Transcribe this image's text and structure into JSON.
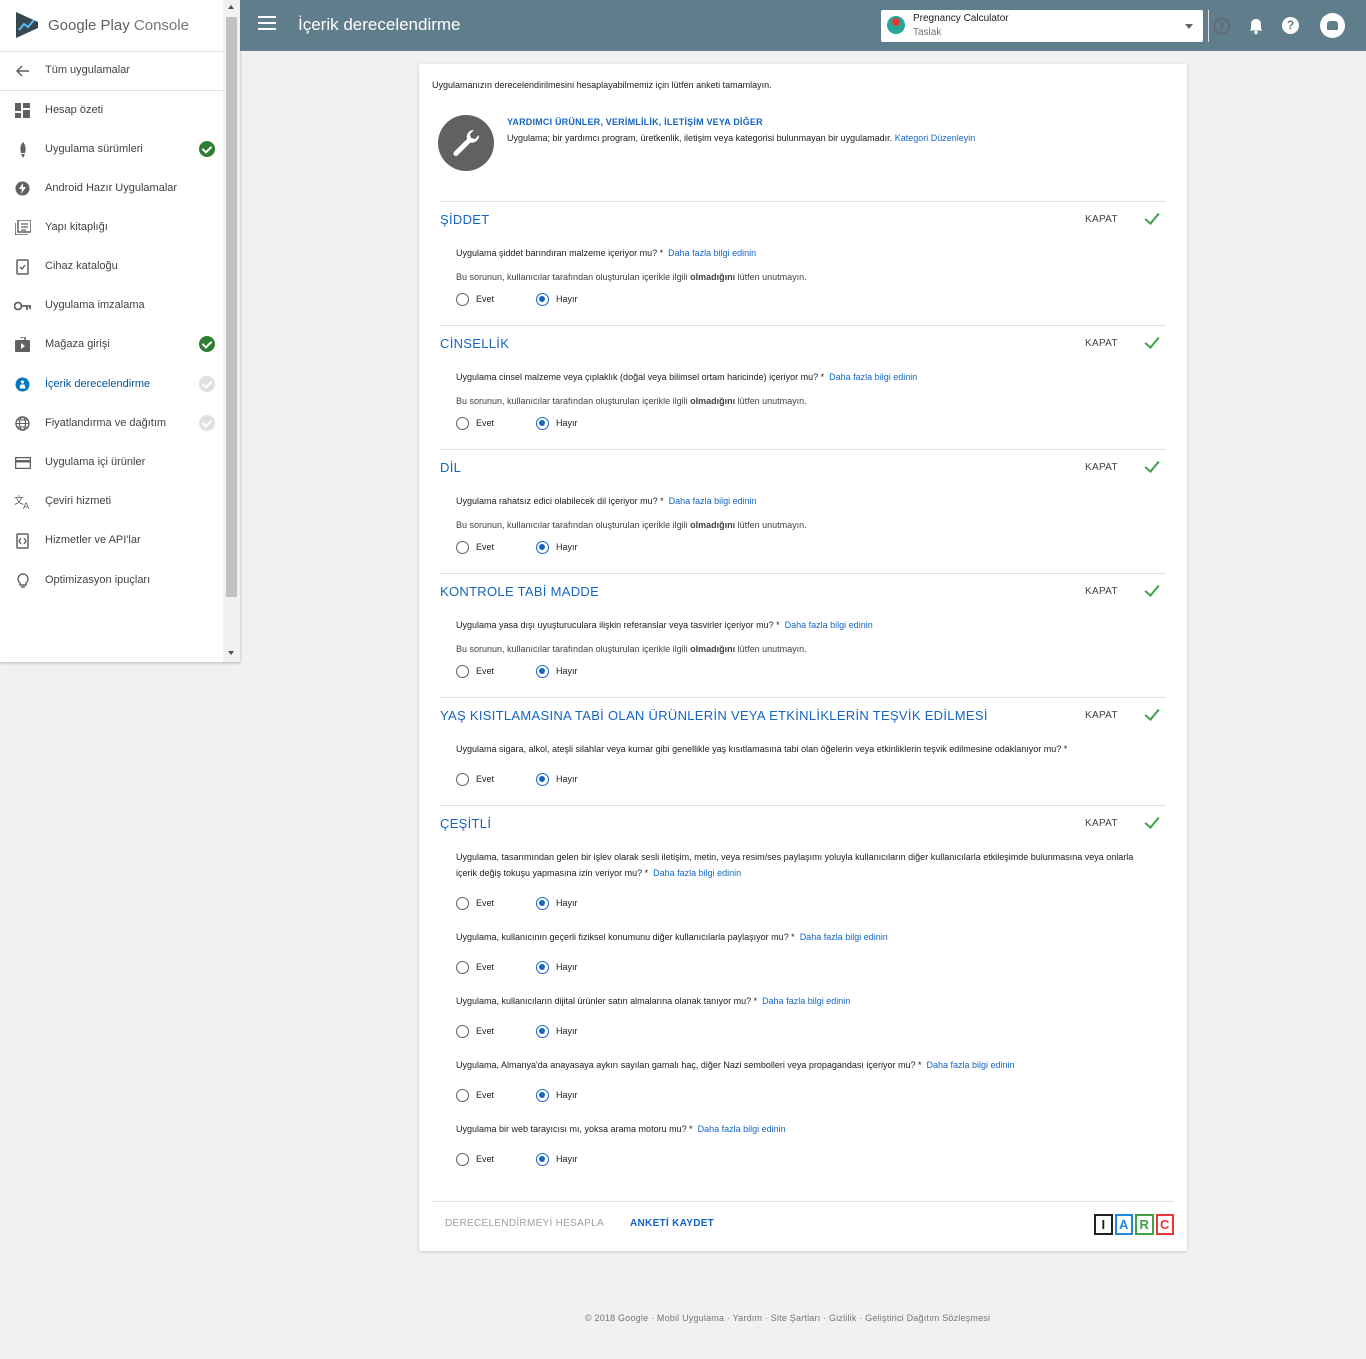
{
  "header": {
    "title": "İçerik derecelendirme",
    "app_name": "Pregnancy Calculator",
    "app_status": "Taslak",
    "info_glyph": "i",
    "help_glyph": "?"
  },
  "logo": {
    "brand": "Google Play",
    "product": "Console"
  },
  "sidebar": {
    "back": "Tüm uygulamalar",
    "items": [
      {
        "label": "Hesap özeti",
        "icon": "dashboard-icon",
        "status": ""
      },
      {
        "label": "Uygulama sürümleri",
        "icon": "rocket-icon",
        "status": "ok"
      },
      {
        "label": "Android Hazır Uygulamalar",
        "icon": "bolt-icon",
        "status": ""
      },
      {
        "label": "Yapı kitaplığı",
        "icon": "library-icon",
        "status": ""
      },
      {
        "label": "Cihaz kataloğu",
        "icon": "device-catalog-icon",
        "status": ""
      },
      {
        "label": "Uygulama imzalama",
        "icon": "key-icon",
        "status": ""
      },
      {
        "label": "Mağaza girişi",
        "icon": "store-icon",
        "status": "ok"
      },
      {
        "label": "İçerik derecelendirme",
        "icon": "rating-icon",
        "status": "pending"
      },
      {
        "label": "Fiyatlandırma ve dağıtım",
        "icon": "globe-icon",
        "status": "pending"
      },
      {
        "label": "Uygulama içi ürünler",
        "icon": "card-icon",
        "status": ""
      },
      {
        "label": "Çeviri hizmeti",
        "icon": "translate-icon",
        "status": ""
      },
      {
        "label": "Hizmetler ve API'lar",
        "icon": "api-icon",
        "status": ""
      },
      {
        "label": "Optimizasyon ipuçları",
        "icon": "lightbulb-icon",
        "status": ""
      }
    ]
  },
  "intro": "Uygulamanızın derecelendirilmesini hesaplayabilmemiz için lütfen anketi tamamlayın.",
  "category": {
    "title": "YARDIMCI ÜRÜNLER, VERİMLİLİK, İLETİŞİM VEYA DİĞER",
    "description": "Uygulama; bir yardımcı program, üretkenlik, iletişim veya kategorisi bulunmayan bir uygulamadır.",
    "edit_link": "Kategori Düzenleyin"
  },
  "common": {
    "close": "KAPAT",
    "yes": "Evet",
    "no": "Hayır",
    "learn_more": "Daha fazla bilgi edinin",
    "note_prefix": "Bu sorunun, kullanıcılar tarafından oluşturulan içerikle ilgili ",
    "note_bold": "olmadığını",
    "note_suffix": " lütfen unutmayın."
  },
  "sections": [
    {
      "title": "ŞİDDET",
      "q": "Uygulama şiddet barındıran malzeme içeriyor mu? *"
    },
    {
      "title": "CİNSELLİK",
      "q": "Uygulama cinsel malzeme veya çıplaklık (doğal veya bilimsel ortam haricinde) içeriyor mu? *"
    },
    {
      "title": "DİL",
      "q": "Uygulama rahatsız edici olabilecek dil içeriyor mu? *"
    },
    {
      "title": "KONTROLE TABİ MADDE",
      "q": "Uygulama yasa dışı uyuşturuculara ilişkin referanslar veya tasvirler içeriyor mu? *"
    },
    {
      "title": "YAŞ KISITLAMASINA TABİ OLAN ÜRÜNLERİN VEYA ETKİNLİKLERİN TEŞVİK EDİLMESİ",
      "q": "Uygulama sigara, alkol, ateşli silahlar veya kumar gibi genellikle yaş kısıtlamasına tabi olan öğelerin veya etkinliklerin teşvik edilmesine odaklanıyor mu? *"
    },
    {
      "title": "ÇEŞİTLİ",
      "q1": "Uygulama, tasarımından gelen bir işlev olarak sesli iletişim, metin, veya resim/ses paylaşımı yoluyla kullanıcıların diğer kullanıcılarla etkileşimde bulunmasına veya onlarla içerik değiş tokuşu yapmasına izin veriyor mu? *",
      "q2": "Uygulama, kullanıcının geçerli fiziksel konumunu diğer kullanıcılarla paylaşıyor mu? *",
      "q3": "Uygulama, kullanıcıların dijital ürünler satın almalarına olanak tanıyor mu? *",
      "q4": "Uygulama, Almanya'da anayasaya aykırı sayılan gamalı haç, diğer Nazi sembolleri veya propagandası içeriyor mu? *",
      "q5": "Uygulama bir web tarayıcısı mı, yoksa arama motoru mu? *"
    }
  ],
  "actions": {
    "calculate": "DERECELENDİRMEYİ HESAPLA",
    "save": "ANKETİ KAYDET"
  },
  "iarc": [
    "I",
    "A",
    "R",
    "C"
  ],
  "colors": {
    "accent": "#1565c0",
    "topbar": "#607d8b",
    "success": "#43a047"
  },
  "footer": "© 2018 Google · Mobil Uygulama · Yardım · Site Şartları · Gizlilik · Geliştirici Dağıtım Sözleşmesi"
}
